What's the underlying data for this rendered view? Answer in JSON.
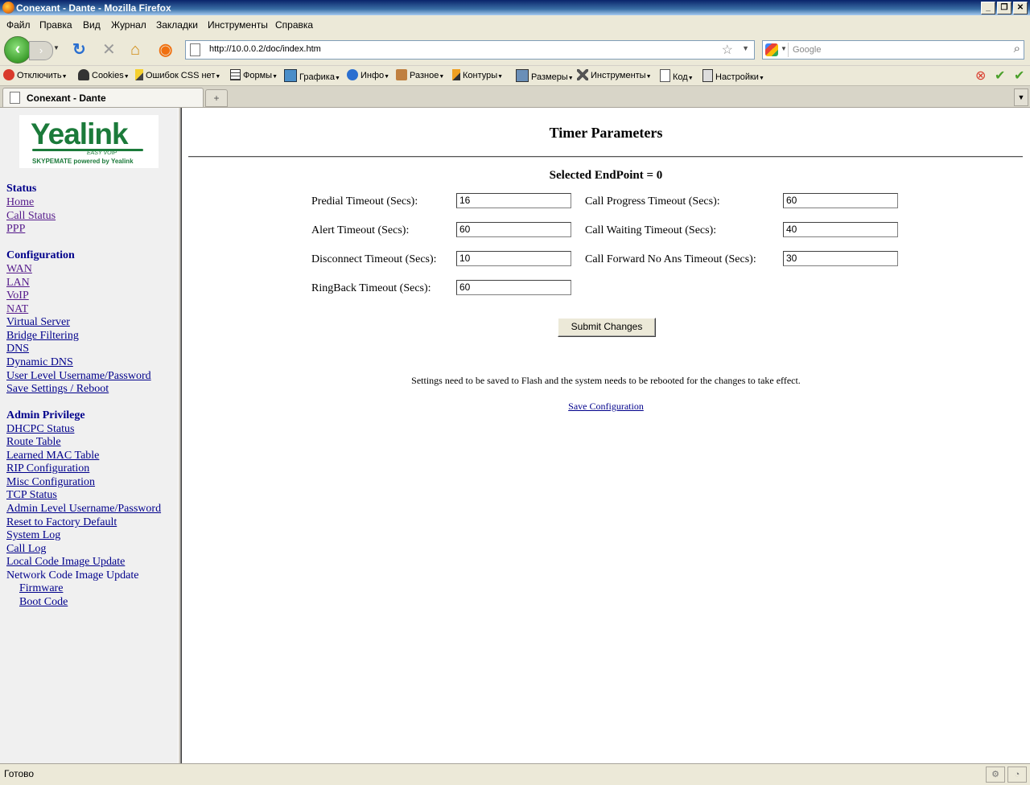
{
  "window": {
    "title": "Conexant - Dante - Mozilla Firefox"
  },
  "menu": [
    "Файл",
    "Правка",
    "Вид",
    "Журнал",
    "Закладки",
    "Инструменты",
    "Справка"
  ],
  "nav": {
    "url": "http://10.0.0.2/doc/index.htm",
    "search_placeholder": "Google"
  },
  "devtoolbar": [
    "Отключить",
    "Cookies",
    "Ошибок CSS нет",
    "Формы",
    "Графика",
    "Инфо",
    "Разное",
    "Контуры",
    "Размеры",
    "Инструменты",
    "Код",
    "Настройки"
  ],
  "tab": {
    "title": "Conexant - Dante"
  },
  "sidebar": {
    "logo": {
      "brand": "Yealink",
      "tagline": "EASY VOIP",
      "subline": "SKYPEMATE powered by Yealink"
    },
    "status_title": "Status",
    "status_links": [
      "Home",
      "Call Status",
      "PPP"
    ],
    "config_title": "Configuration",
    "config_links": [
      "WAN",
      "LAN",
      "VoIP",
      "NAT",
      "Virtual Server",
      "Bridge Filtering",
      "DNS",
      "Dynamic DNS",
      "User Level Username/Password",
      "Save Settings / Reboot"
    ],
    "admin_title": "Admin Privilege",
    "admin_links": [
      "DHCPC Status",
      "Route Table",
      "Learned MAC Table",
      "RIP Configuration",
      "Misc Configuration",
      "TCP Status",
      "Admin Level Username/Password",
      "Reset to Factory Default",
      "System Log",
      "Call Log",
      "Local Code Image Update"
    ],
    "network_update": "Network Code Image Update",
    "network_links": [
      "Firmware",
      "Boot Code"
    ]
  },
  "main": {
    "title": "Timer Parameters",
    "selected": "Selected EndPoint = 0",
    "fields": {
      "predial_label": "Predial Timeout (Secs):",
      "predial": "16",
      "alert_label": "Alert Timeout (Secs):",
      "alert": "60",
      "disconnect_label": "Disconnect Timeout (Secs):",
      "disconnect": "10",
      "ringback_label": "RingBack Timeout (Secs):",
      "ringback": "60",
      "progress_label": "Call Progress Timeout (Secs):",
      "progress": "60",
      "waiting_label": "Call Waiting Timeout (Secs):",
      "waiting": "40",
      "forward_label": "Call Forward No Ans Timeout (Secs):",
      "forward": "30"
    },
    "submit": "Submit Changes",
    "note": "Settings need to be saved to Flash and the system needs to be rebooted for the changes to take effect.",
    "save_link": "Save Configuration"
  },
  "status": {
    "text": "Готово"
  }
}
